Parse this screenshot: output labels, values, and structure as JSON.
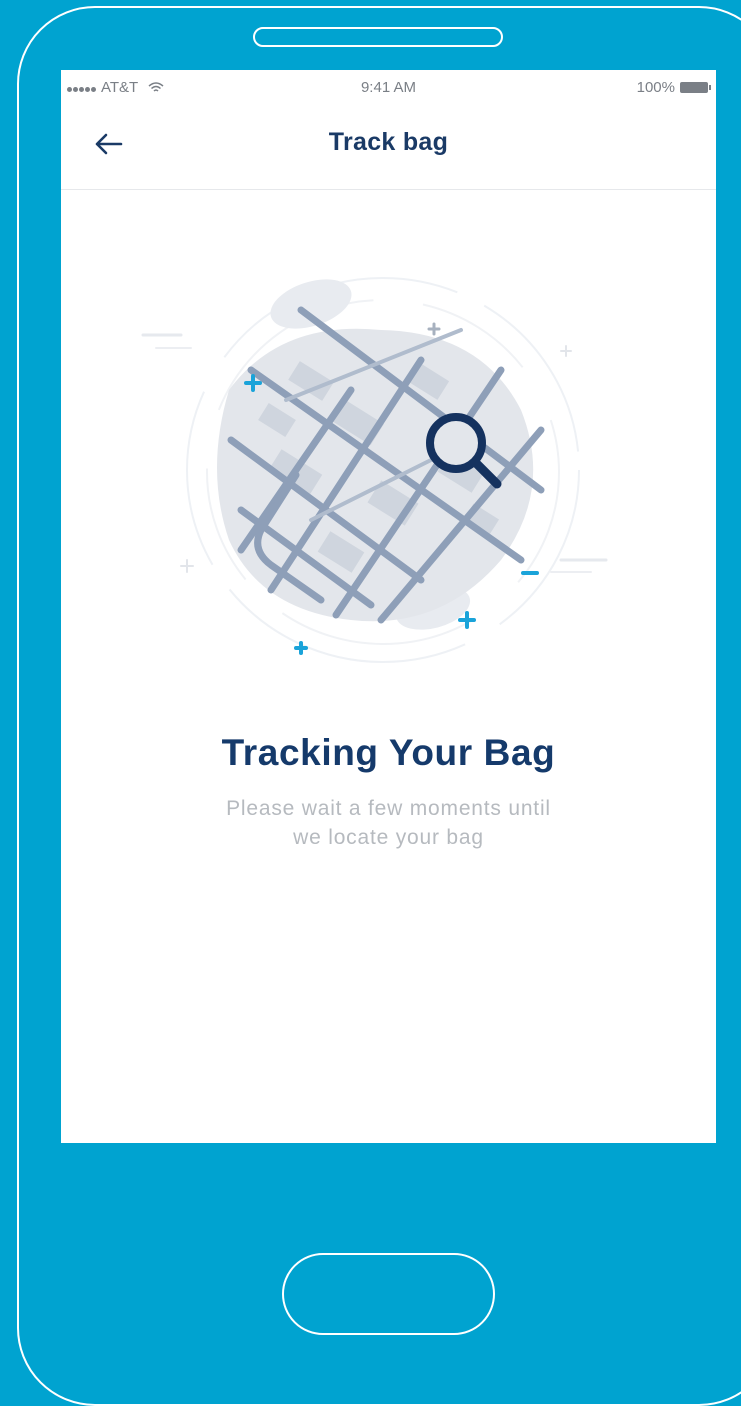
{
  "status_bar": {
    "carrier": "AT&T",
    "time": "9:41 AM",
    "battery": "100%"
  },
  "nav": {
    "title": "Track bag",
    "back_icon": "back-arrow-icon"
  },
  "content": {
    "illustration_icon": "map-search-illustration",
    "heading": "Tracking Your Bag",
    "message_line1": "Please wait a few moments until",
    "message_line2": "we locate your bag"
  },
  "colors": {
    "frame": "#00a3d0",
    "title": "#1a3a66",
    "accent": "#1aa3d9",
    "map_road": "#8e9fb8",
    "subtext": "#b6babf"
  }
}
